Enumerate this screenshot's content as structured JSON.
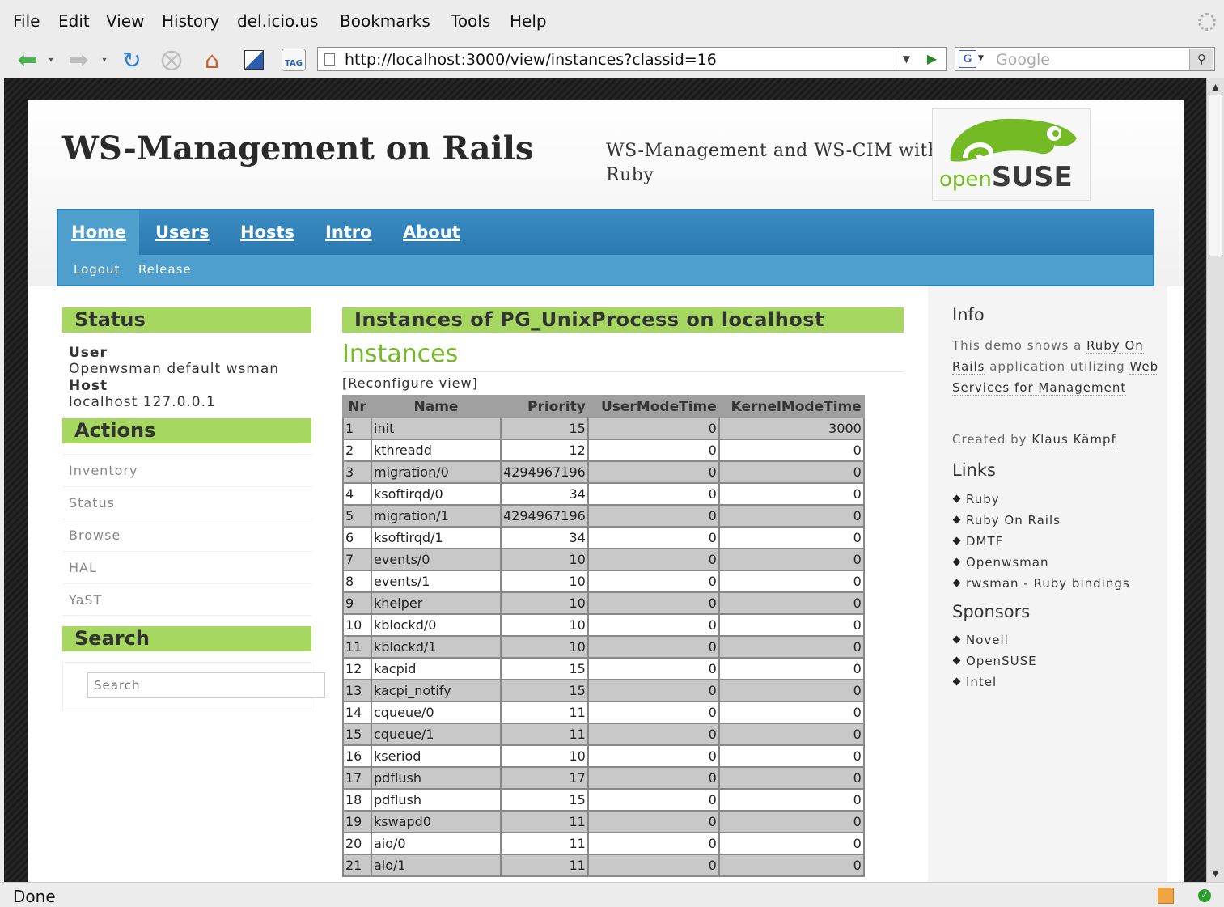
{
  "browser": {
    "menu": [
      "File",
      "Edit",
      "View",
      "History",
      "del.icio.us",
      "Bookmarks",
      "Tools",
      "Help"
    ],
    "url": "http://localhost:3000/view/instances?classid=16",
    "search_placeholder": "Google",
    "status": "Done"
  },
  "site": {
    "title": "WS-Management on Rails",
    "subtitle": "WS-Management and WS-CIM with Ruby",
    "logo_open": "open",
    "logo_suse": "SUSE"
  },
  "nav": {
    "tabs": [
      "Home",
      "Users",
      "Hosts",
      "Intro",
      "About"
    ],
    "sub": [
      "Logout",
      "Release"
    ]
  },
  "left": {
    "status_heading": "Status",
    "user_label": "User",
    "user_value": "Openwsman default wsman",
    "host_label": "Host",
    "host_value": "localhost 127.0.0.1",
    "actions_heading": "Actions",
    "actions": [
      "Inventory",
      "Status",
      "Browse",
      "HAL",
      "YaST"
    ],
    "search_heading": "Search",
    "search_placeholder": "Search"
  },
  "main": {
    "heading": "Instances of PG_UnixProcess on localhost",
    "title": "Instances",
    "reconfigure": "[Reconfigure view]",
    "columns": [
      "Nr",
      "Name",
      "Priority",
      "UserModeTime",
      "KernelModeTime"
    ],
    "rows": [
      [
        "1",
        "init",
        "15",
        "0",
        "3000"
      ],
      [
        "2",
        "kthreadd",
        "12",
        "0",
        "0"
      ],
      [
        "3",
        "migration/0",
        "4294967196",
        "0",
        "0"
      ],
      [
        "4",
        "ksoftirqd/0",
        "34",
        "0",
        "0"
      ],
      [
        "5",
        "migration/1",
        "4294967196",
        "0",
        "0"
      ],
      [
        "6",
        "ksoftirqd/1",
        "34",
        "0",
        "0"
      ],
      [
        "7",
        "events/0",
        "10",
        "0",
        "0"
      ],
      [
        "8",
        "events/1",
        "10",
        "0",
        "0"
      ],
      [
        "9",
        "khelper",
        "10",
        "0",
        "0"
      ],
      [
        "10",
        "kblockd/0",
        "10",
        "0",
        "0"
      ],
      [
        "11",
        "kblockd/1",
        "10",
        "0",
        "0"
      ],
      [
        "12",
        "kacpid",
        "15",
        "0",
        "0"
      ],
      [
        "13",
        "kacpi_notify",
        "15",
        "0",
        "0"
      ],
      [
        "14",
        "cqueue/0",
        "11",
        "0",
        "0"
      ],
      [
        "15",
        "cqueue/1",
        "11",
        "0",
        "0"
      ],
      [
        "16",
        "kseriod",
        "10",
        "0",
        "0"
      ],
      [
        "17",
        "pdflush",
        "17",
        "0",
        "0"
      ],
      [
        "18",
        "pdflush",
        "15",
        "0",
        "0"
      ],
      [
        "19",
        "kswapd0",
        "11",
        "0",
        "0"
      ],
      [
        "20",
        "aio/0",
        "11",
        "0",
        "0"
      ],
      [
        "21",
        "aio/1",
        "11",
        "0",
        "0"
      ]
    ]
  },
  "right": {
    "info_heading": "Info",
    "info_pre": "This demo shows a",
    "info_link1": "Ruby On Rails",
    "info_mid": "application utilizing",
    "info_link2": "Web Services for Management",
    "created_pre": "Created by",
    "created_link": "Klaus Kämpf",
    "links_heading": "Links",
    "links": [
      "Ruby",
      "Ruby On Rails",
      "DMTF",
      "Openwsman",
      "rwsman - Ruby bindings"
    ],
    "sponsors_heading": "Sponsors",
    "sponsors": [
      "Novell",
      "OpenSUSE",
      "Intel"
    ]
  }
}
